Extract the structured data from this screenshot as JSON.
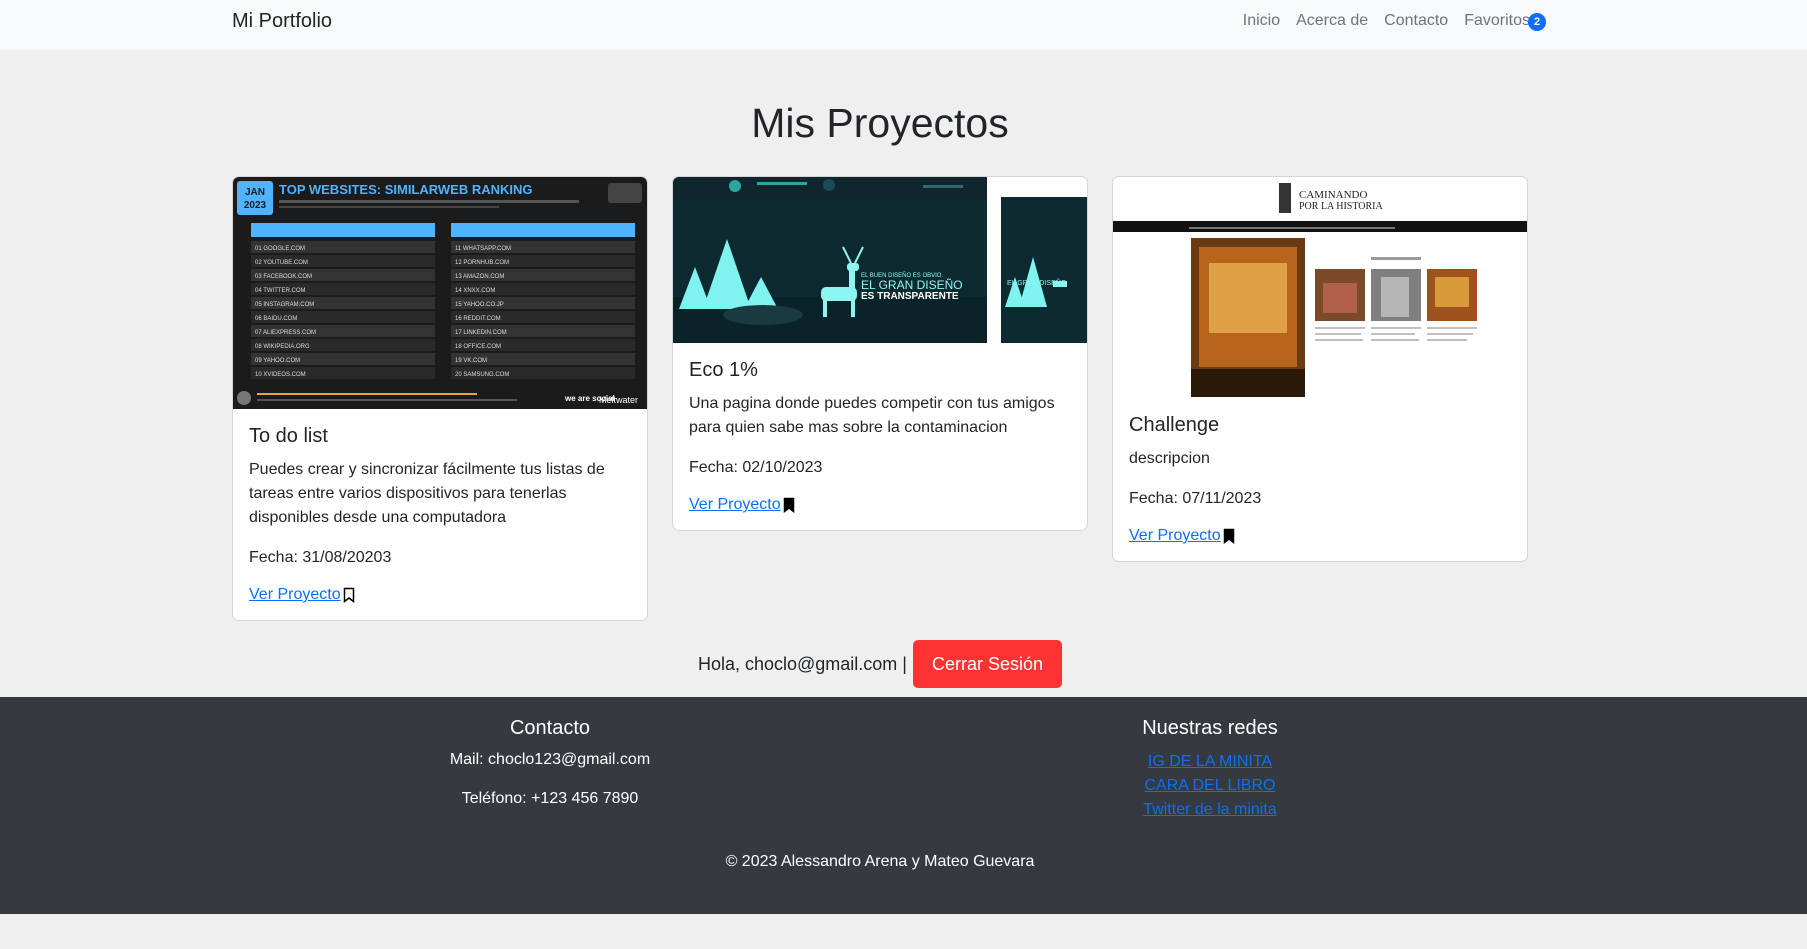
{
  "nav": {
    "brand": "Mi Portfolio",
    "links": [
      "Inicio",
      "Acerca de",
      "Contacto",
      "Favoritos"
    ],
    "favorites_count": "2"
  },
  "page_title": "Mis Proyectos",
  "projects": [
    {
      "title": "To do list",
      "description": "Puedes crear y sincronizar fácilmente tus listas de tareas entre varios dispositivos para tenerlas disponibles desde una computadora",
      "date": "Fecha: 31/08/20203",
      "link": "Ver Proyecto",
      "bookmarked": false,
      "image": {
        "badge_top": "JAN",
        "badge_year": "2023",
        "heading": "TOP WEBSITES: SIMILARWEB RANKING",
        "sites_left": [
          "GOOGLE.COM",
          "YOUTUBE.COM",
          "FACEBOOK.COM",
          "TWITTER.COM",
          "INSTAGRAM.COM",
          "BAIDU.COM",
          "ALIEXPRESS.COM",
          "WIKIPEDIA.ORG",
          "YAHOO.COM",
          "XVIDEOS.COM"
        ],
        "sites_right": [
          "WHATSAPP.COM",
          "PORNHUB.COM",
          "AMAZON.COM",
          "XNXX.COM",
          "YAHOO.CO.JP",
          "REDDIT.COM",
          "LINKEDIN.COM",
          "OFFICE.COM",
          "VK.COM",
          "SAMSUNG.COM"
        ],
        "brand_a": "we are social",
        "brand_b": "Meltwater"
      }
    },
    {
      "title": "Eco 1%",
      "description": "Una pagina donde puedes competir con tus amigos para quien sabe mas sobre la contaminacion",
      "date": "Fecha: 02/10/2023",
      "link": "Ver Proyecto",
      "bookmarked": true,
      "image": {
        "tagline_1": "EL BUEN DISEÑO ES OBVIO.",
        "tagline_2": "EL GRAN DISEÑO",
        "tagline_3": "ES TRANSPARENTE"
      }
    },
    {
      "title": "Challenge",
      "description": "descripcion",
      "date": "Fecha: 07/11/2023",
      "link": "Ver Proyecto",
      "bookmarked": true,
      "image": {
        "logo_line_1": "CAMINANDO",
        "logo_line_2": "POR LA HISTORIA"
      }
    }
  ],
  "session": {
    "greeting": "Hola, choclo@gmail.com |",
    "logout_label": "Cerrar Sesión"
  },
  "footer": {
    "contact_title": "Contacto",
    "mail": "Mail: choclo123@gmail.com",
    "phone": "Teléfono: +123 456 7890",
    "social_title": "Nuestras redes",
    "social_links": [
      "IG DE LA MINITA",
      "CARA DEL LIBRO",
      "Twitter de la minita"
    ],
    "copyright": "© 2023 Alessandro Arena y Mateo Guevara"
  },
  "colors": {
    "accent": "#0d6efd",
    "danger": "#ff3333",
    "footer_bg": "#343a40",
    "page_bg": "#efefef"
  }
}
